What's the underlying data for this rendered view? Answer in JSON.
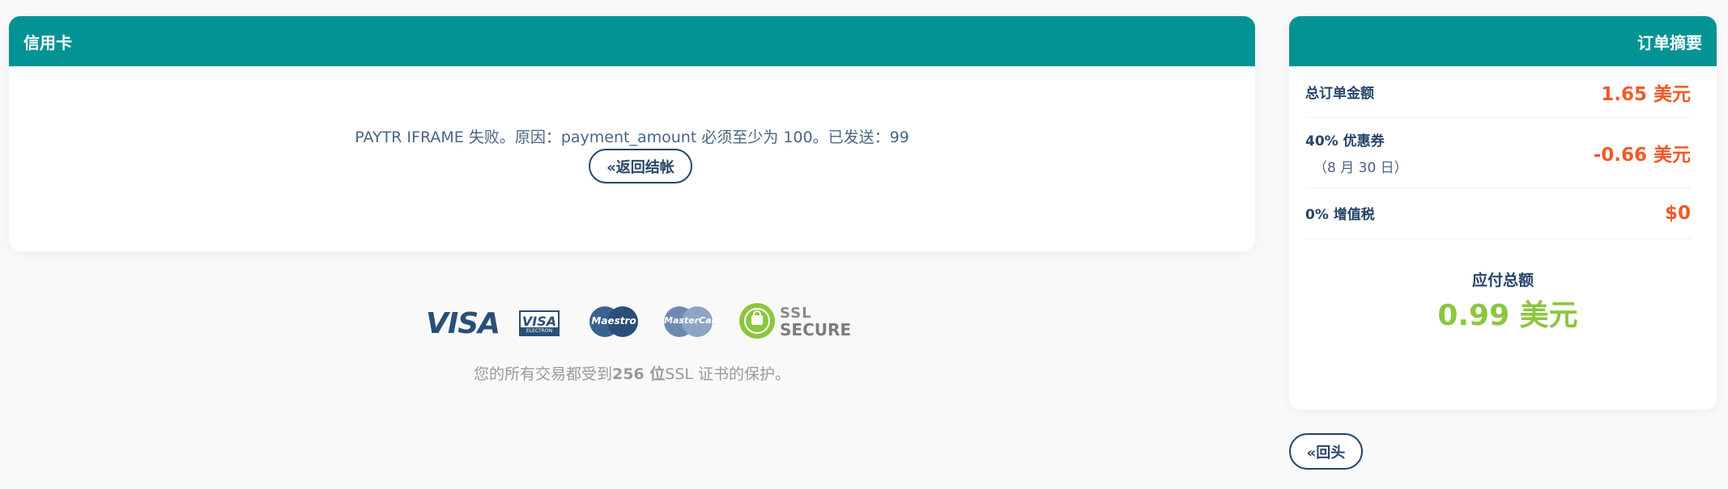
{
  "credit_card": {
    "title": "信用卡",
    "error_message": "PAYTR IFRAME 失败。原因：payment_amount 必须至少为 100。已发送：99",
    "back_checkout_label": "«返回结帐"
  },
  "payment_logos": {
    "visa": "VISA",
    "visa_electron": "VISA",
    "visa_electron_sub": "ELECTRON",
    "maestro": "Maestro",
    "mastercard": "MasterCard",
    "ssl_line1": "SSL",
    "ssl_line2": "SECURE",
    "secure_note_before": "您的所有交易都受到",
    "secure_note_bold": "256 位",
    "secure_note_after": "SSL 证书的保护。"
  },
  "summary": {
    "title": "订单摘要",
    "rows": [
      {
        "label": "总订单金额",
        "sub": "",
        "value": "1.65 美元"
      },
      {
        "label": "40% 优惠券",
        "sub": "（8 月 30 日）",
        "value": "-0.66 美元"
      },
      {
        "label": "0% 增值税",
        "sub": "",
        "value": "$0"
      }
    ],
    "total_label": "应付总额",
    "total_value": "0.99 美元"
  },
  "back_label": "«回头",
  "colors": {
    "header": "#039395",
    "accent_orange": "#f05a28",
    "accent_green": "#8cc63f",
    "navy": "#26456a"
  }
}
